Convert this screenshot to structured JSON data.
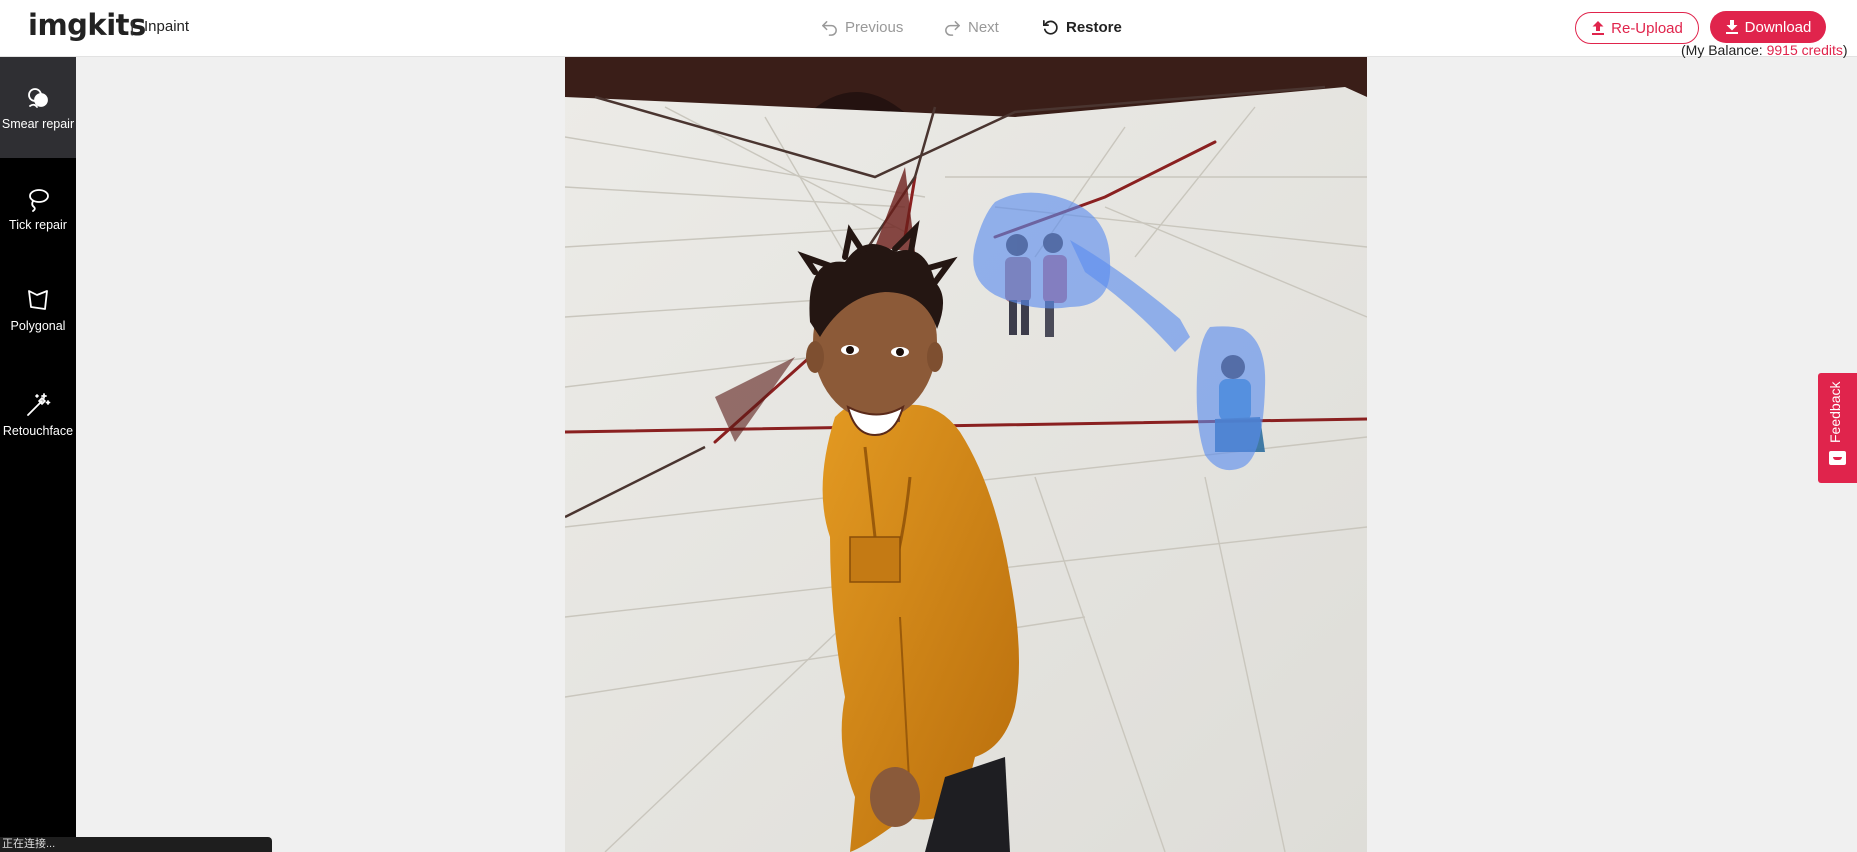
{
  "header": {
    "logo": "imgkits",
    "separator": "|",
    "app_name": "Inpaint",
    "nav": {
      "previous": "Previous",
      "next": "Next",
      "restore": "Restore"
    },
    "reupload_label": "Re-Upload",
    "download_label": "Download",
    "balance": {
      "prefix": "(My Balance: ",
      "credits": "9915 credits",
      "suffix": ")"
    }
  },
  "sidebar": {
    "tools": [
      {
        "label": "Smear repair",
        "icon": "smear-brush-icon",
        "active": true
      },
      {
        "label": "Tick repair",
        "icon": "lasso-icon",
        "active": false
      },
      {
        "label": "Polygonal",
        "icon": "polygon-icon",
        "active": false
      },
      {
        "label": "Retouchface",
        "icon": "magic-wand-icon",
        "active": false
      }
    ]
  },
  "feedback_label": "Feedback",
  "status_text": "正在连接...",
  "colors": {
    "accent": "#e0244c",
    "sidebar_bg": "#000000",
    "sidebar_active": "#2f2f33",
    "mask": "#5b8def"
  }
}
